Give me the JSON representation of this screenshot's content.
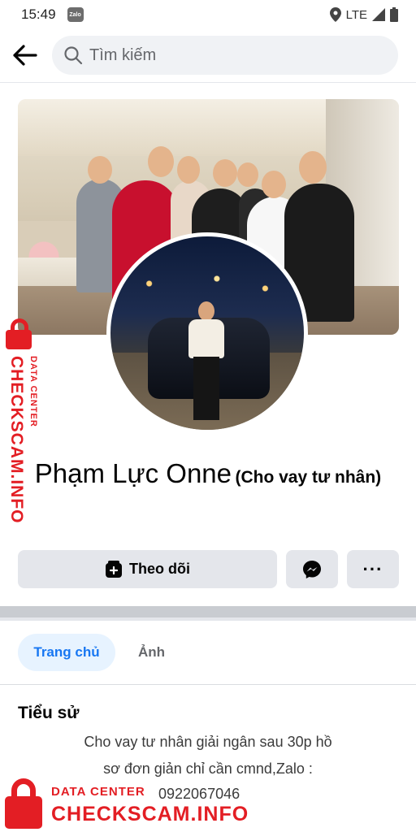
{
  "status_bar": {
    "time": "15:49",
    "app_badge": "Zalo",
    "network": "LTE",
    "icons": [
      "location-icon",
      "signal-icon",
      "battery-icon"
    ]
  },
  "header": {
    "search_placeholder": "Tìm kiếm",
    "back_icon": "back-arrow-icon",
    "search_icon": "search-icon"
  },
  "profile": {
    "name": "Phạm Lực Onne",
    "name_suffix": "(Cho vay tư nhân)"
  },
  "actions": {
    "follow_label": "Theo dõi",
    "messenger_icon": "messenger-icon",
    "more_label": "···"
  },
  "tabs": [
    {
      "label": "Trang chủ",
      "active": true
    },
    {
      "label": "Ảnh",
      "active": false
    }
  ],
  "bio": {
    "title": "Tiểu sử",
    "line1": "Cho vay tư nhân giải ngân sau 30p hồ",
    "line2": "sơ đơn giản chỉ cần cmnd,Zalo :",
    "line3": "0922067046"
  },
  "watermark": {
    "small_text": "DATA CENTER",
    "big_text": "CHECKSCAM.INFO"
  },
  "colors": {
    "accent": "#1877f2",
    "watermark": "#e31e24",
    "button_bg": "#e4e6eb",
    "tab_active_bg": "#e7f3ff"
  }
}
